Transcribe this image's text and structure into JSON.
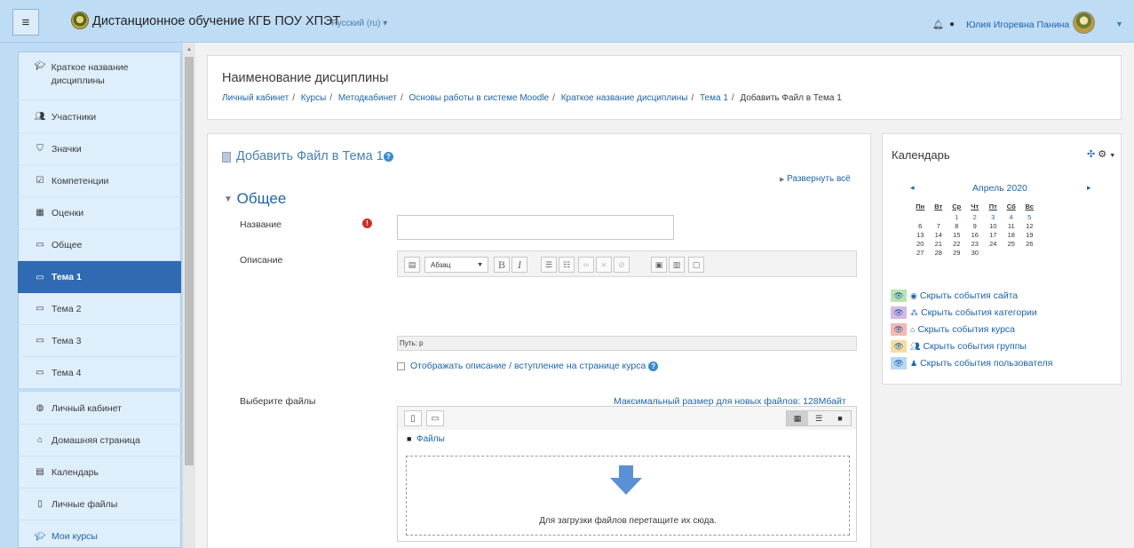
{
  "header": {
    "site_title": "Дистанционное обучение КГБ ПОУ ХПЭТ",
    "language": "Русский (ru) ▾",
    "user_name": "Юлия Игоревна Панина"
  },
  "sidebar": {
    "items": [
      {
        "label": "Краткое название дисциплины",
        "icon": "graduation-cap-icon"
      },
      {
        "label": "Участники",
        "icon": "users-icon"
      },
      {
        "label": "Значки",
        "icon": "shield-icon"
      },
      {
        "label": "Компетенции",
        "icon": "checkbox-icon"
      },
      {
        "label": "Оценки",
        "icon": "table-icon"
      },
      {
        "label": "Общее",
        "icon": "folder-icon"
      },
      {
        "label": "Тема 1",
        "icon": "folder-icon"
      },
      {
        "label": "Тема 2",
        "icon": "folder-icon"
      },
      {
        "label": "Тема 3",
        "icon": "folder-icon"
      },
      {
        "label": "Тема 4",
        "icon": "folder-icon"
      },
      {
        "label": "Личный кабинет",
        "icon": "dashboard-icon"
      },
      {
        "label": "Домашняя страница",
        "icon": "home-icon"
      },
      {
        "label": "Календарь",
        "icon": "calendar-icon"
      },
      {
        "label": "Личные файлы",
        "icon": "file-icon"
      },
      {
        "label": "Мои курсы",
        "icon": "graduation-cap-icon"
      }
    ]
  },
  "course": {
    "name": "Наименование дисциплины",
    "breadcrumbs": [
      "Личный кабинет",
      "Курсы",
      "Методкабинет",
      "Основы работы в системе Moodle",
      "Краткое название дисциплины",
      "Тема 1",
      "Добавить Файл в Тема 1"
    ]
  },
  "form": {
    "page_title": "Добавить Файл в Тема 1",
    "expand_all": "Развернуть всё",
    "section_title": "Общее",
    "name_label": "Название",
    "name_value": "",
    "description_label": "Описание",
    "format_select": "Абзац",
    "path_text": "Путь: p",
    "show_description_label": "Отображать описание / вступление на странице курса",
    "files_label": "Выберите файлы",
    "max_size": "Максимальный размер для новых файлов: 128Мбайт",
    "folder_label": "Файлы",
    "drop_text": "Для загрузки файлов перетащите их сюда."
  },
  "calendar": {
    "title": "Календарь",
    "month": "Апрель 2020",
    "days_of_week": [
      "Пн",
      "Вт",
      "Ср",
      "Чт",
      "Пт",
      "Сб",
      "Вс"
    ],
    "weeks": [
      [
        "",
        "",
        "1",
        "2",
        "3",
        "4",
        "5"
      ],
      [
        "6",
        "7",
        "8",
        "9",
        "10",
        "11",
        "12"
      ],
      [
        "13",
        "14",
        "15",
        "16",
        "17",
        "18",
        "19"
      ],
      [
        "20",
        "21",
        "22",
        "23",
        "24",
        "25",
        "26"
      ],
      [
        "27",
        "28",
        "29",
        "30",
        "",
        "",
        ""
      ]
    ],
    "events": [
      {
        "label": "Скрыть события сайта",
        "color": "#b9e3b0",
        "icon": "globe-icon"
      },
      {
        "label": "Скрыть события категории",
        "color": "#d6b9e6",
        "icon": "cubes-icon"
      },
      {
        "label": "Скрыть события курса",
        "color": "#f5b7b1",
        "icon": "university-icon"
      },
      {
        "label": "Скрыть события группы",
        "color": "#f7dca0",
        "icon": "group-icon"
      },
      {
        "label": "Скрыть события пользователя",
        "color": "#b9d7f2",
        "icon": "user-icon"
      }
    ]
  },
  "colors": {
    "navbar": "#bfdcf5",
    "active_item": "#2f6ab3",
    "link": "#1e64aa"
  }
}
